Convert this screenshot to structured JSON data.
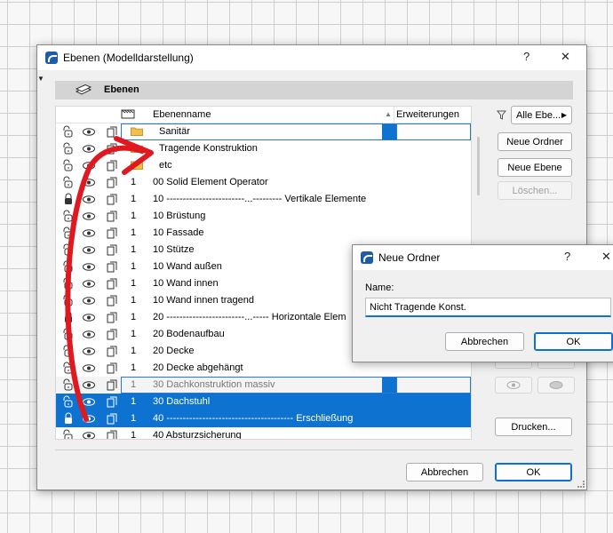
{
  "dialog": {
    "title": "Ebenen (Modelldarstellung)",
    "help": "?",
    "close": "✕",
    "header_label": "Ebenen",
    "columns": {
      "name": "Ebenenname",
      "extensions": "Erweiterungen"
    },
    "rows": [
      {
        "kind": "folder",
        "name": "Sanitär",
        "state": "edit"
      },
      {
        "kind": "folder",
        "name": "Tragende Konstruktion"
      },
      {
        "kind": "folder",
        "name": "etc"
      },
      {
        "kind": "layer",
        "num": "1",
        "name": "00 Solid Element Operator"
      },
      {
        "kind": "layer",
        "num": "1",
        "name": "10 ------------------------...--------- Vertikale Elemente",
        "lock": "closed"
      },
      {
        "kind": "layer",
        "num": "1",
        "name": "10 Brüstung"
      },
      {
        "kind": "layer",
        "num": "1",
        "name": "10 Fassade"
      },
      {
        "kind": "layer",
        "num": "1",
        "name": "10 Stütze"
      },
      {
        "kind": "layer",
        "num": "1",
        "name": "10 Wand außen"
      },
      {
        "kind": "layer",
        "num": "1",
        "name": "10 Wand innen"
      },
      {
        "kind": "layer",
        "num": "1",
        "name": "10 Wand innen tragend"
      },
      {
        "kind": "layer",
        "num": "1",
        "name": "20 ------------------------...----- Horizontale Elem",
        "lock": "closed"
      },
      {
        "kind": "layer",
        "num": "1",
        "name": "20 Bodenaufbau"
      },
      {
        "kind": "layer",
        "num": "1",
        "name": "20 Decke"
      },
      {
        "kind": "layer",
        "num": "1",
        "name": "20 Decke abgehängt"
      },
      {
        "kind": "layer",
        "num": "1",
        "name": "30 Dachkonstruktion massiv",
        "state": "dim"
      },
      {
        "kind": "layer",
        "num": "1",
        "name": "30 Dachstuhl",
        "state": "sel"
      },
      {
        "kind": "layer",
        "num": "1",
        "name": "40 --------------------------------------- Erschließung",
        "state": "sel",
        "lock": "closed"
      },
      {
        "kind": "layer",
        "num": "1",
        "name": "40 Absturzsicherung"
      }
    ],
    "filter_dropdown": "Alle Ebe...",
    "buttons": {
      "new_folder": "Neue Ordner",
      "new_layer": "Neue Ebene",
      "delete": "Löschen...",
      "print": "Drucken...",
      "cancel": "Abbrechen",
      "ok": "OK"
    }
  },
  "new_folder_dialog": {
    "title": "Neue Ordner",
    "help": "?",
    "close": "✕",
    "name_label": "Name:",
    "name_value": "Nicht Tragende Konst.",
    "cancel": "Abbrechen",
    "ok": "OK"
  },
  "colors": {
    "selection": "#0d72d0",
    "annotation_arrow": "#e0181f"
  }
}
